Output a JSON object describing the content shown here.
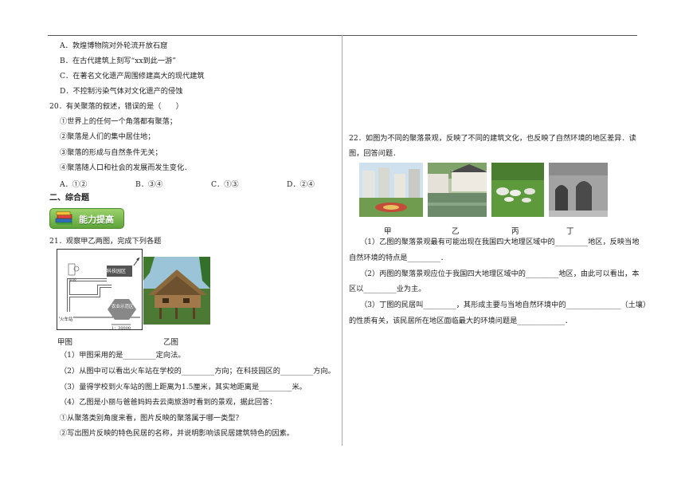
{
  "left": {
    "q19_options": [
      "A．敦煌博物院对外轮流开放石窟",
      "B．在古代建筑上刻写“xx到此一游”",
      "C．在著名文化遗产周围修建高大的现代建筑",
      "D．不控制污染气体对文化遗产的侵蚀"
    ],
    "q20_stem": "20．有关聚落的叙述，错误的是（　　）",
    "q20_items": [
      "①世界上的任何一个角落都有聚落；",
      "②聚落是人们的集中居住地；",
      "③聚落的形成与自然条件无关；",
      "④聚落随人口和社会的发展而发生变化．"
    ],
    "q20_choices": [
      "A．①②",
      "B．③④",
      "C．①③",
      "D．②④"
    ],
    "section_title": "二、综合题",
    "badge_text": "能力提高",
    "q21_stem": "21．观察甲乙两图，完成下列各题",
    "map_labels": {
      "school": "学校",
      "tech_park": "科技园区",
      "agri_base": "农业示范区",
      "station": "火车站",
      "scale": "1：30000"
    },
    "fig_jia": "甲图",
    "fig_yi": "乙图",
    "q21_subs": [
      "（1）甲图采用的是_________定向法。",
      "（2）从图中可以看出火车站在学校的_________方向；在科技园区的_________方向。",
      "（3）量得学校到火车站的图上距离为1.5厘米，其实地距离是_________米。",
      "（4）乙图是小丽与爸爸妈妈去云南旅游时看到的景观，据此回答：",
      "①从聚落类别角度来看，图片反映的聚落属于哪一类型？",
      "②写出图片反映的特色民居的名称，并说明影响该民居建筑特色的因素。"
    ]
  },
  "right": {
    "q22_stem_line1": "22．如图为不同的聚落景观，反映了不同的建筑文化，也反映了自然环境的地区差异．读",
    "q22_stem_line2": "图，回答问题．",
    "photo_labels": [
      "甲",
      "乙",
      "丙",
      "丁"
    ],
    "q22_lines": [
      "（1）乙图的聚落景观最有可能出现在我国四大地理区域中的_________地区，反映当地",
      "自然环境的特点是_________．",
      "（2）丙图的聚落景观应位于我国四大地理区域中的_________地区，由此可以看出，本",
      "区以_________业为主。",
      "（3）丁图的民居叫_________，其形成主要与当地自然环境中的_______________（土壤）",
      "的性质有关，该民居所在地区面临最大的环境问题是_____________．"
    ]
  }
}
